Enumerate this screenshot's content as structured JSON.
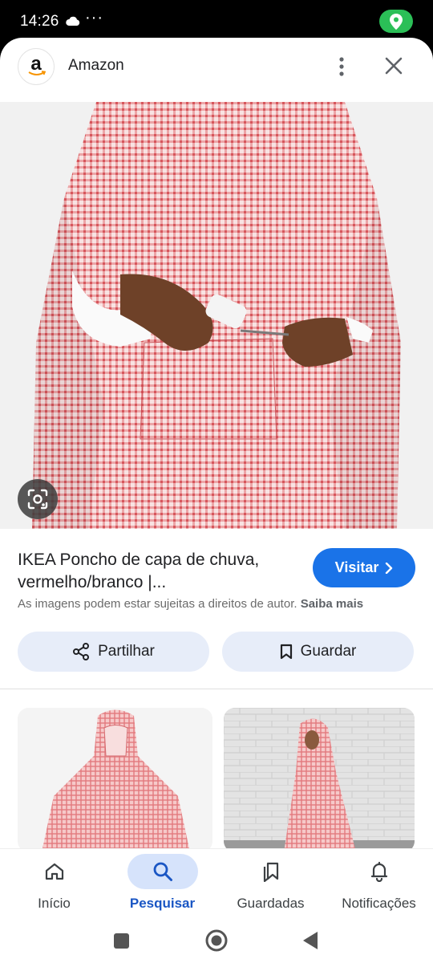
{
  "status_bar": {
    "time": "14:26",
    "extra": "···",
    "icons": [
      "cloud-icon",
      "location-icon"
    ],
    "location_color": "#2bbf57"
  },
  "header": {
    "source_name": "Amazon",
    "logo_letter": "a",
    "icons": [
      "more-vert-icon",
      "close-icon"
    ]
  },
  "result": {
    "title": "IKEA Poncho de capa de chuva, vermelho/branco |...",
    "visit_label": "Visitar",
    "copyright_text": "As imagens podem estar sujeitas a direitos de autor.",
    "learn_more": "Saiba mais"
  },
  "actions": {
    "share_label": "Partilhar",
    "save_label": "Guardar"
  },
  "bottom_nav": {
    "items": [
      {
        "label": "Início",
        "icon": "home-icon"
      },
      {
        "label": "Pesquisar",
        "icon": "search-icon",
        "active": true
      },
      {
        "label": "Guardadas",
        "icon": "bookmarks-icon"
      },
      {
        "label": "Notificações",
        "icon": "bell-icon"
      }
    ]
  },
  "colors": {
    "accent": "#1a73e8",
    "chip_bg": "#e7edf9",
    "poncho": "#e7787c"
  }
}
